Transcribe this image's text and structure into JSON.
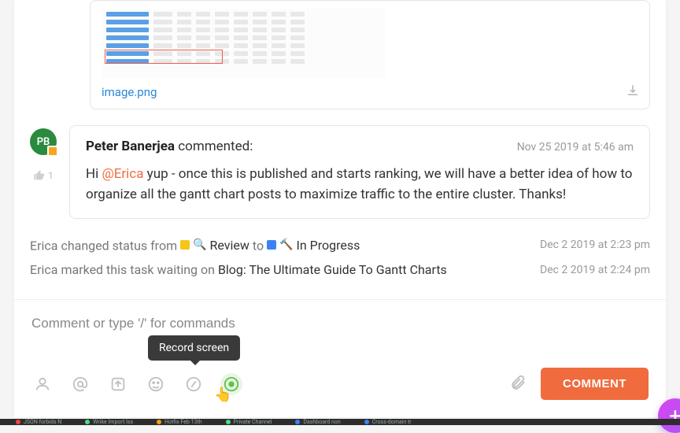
{
  "attachment": {
    "filename": "image.png"
  },
  "comment": {
    "avatar_initials": "PB",
    "author": "Peter Banerjea",
    "verb": "commented:",
    "timestamp": "Nov 25 2019 at 5:46 am",
    "like_count": "1",
    "body_prefix": "Hi ",
    "mention": "@Erica",
    "body_rest": " yup - once this is published and starts ranking, we will have a better idea of how to organize all the gantt chart posts to maximize traffic to the entire cluster. Thanks!"
  },
  "activity": {
    "row1_prefix": "Erica changed status from ",
    "status_from": "Review",
    "mid": " to ",
    "status_to": "In Progress",
    "row1_time": "Dec 2 2019 at 2:23 pm",
    "row2_prefix": "Erica marked this task waiting on ",
    "row2_task": "Blog: The Ultimate Guide To Gantt Charts",
    "row2_time": "Dec 2 2019 at 2:24 pm"
  },
  "composer": {
    "placeholder": "Comment or type '/' for commands",
    "tooltip": "Record screen",
    "submit_label": "COMMENT"
  },
  "taskbar": {
    "t1": "JSON forbids N",
    "t2": "Wrike Import Iss",
    "t3": "Hotfix Feb 13th",
    "t4": "Private Channel",
    "t5": "Dashboard non",
    "t6": "Cross-domain tr"
  }
}
